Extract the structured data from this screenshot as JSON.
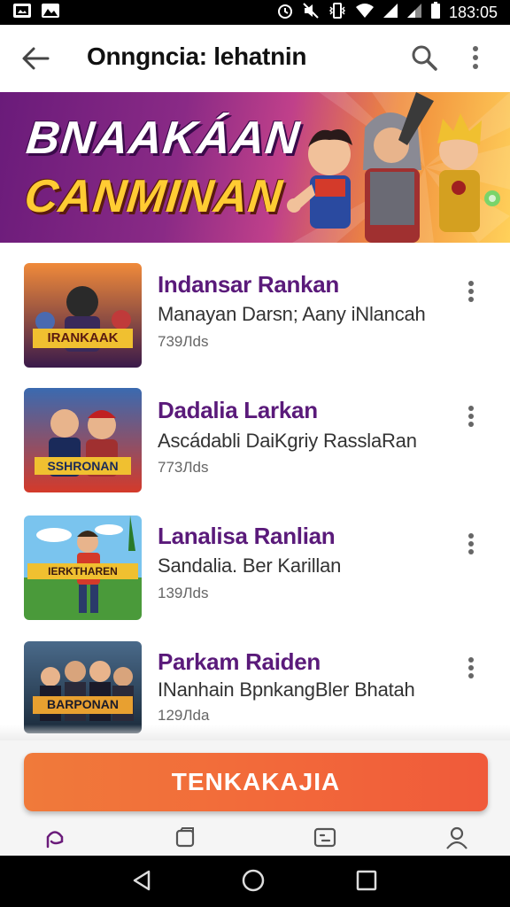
{
  "status_bar": {
    "time": "183:05",
    "icons": [
      "gallery-icon",
      "photo-icon",
      "alarm-icon",
      "mute-icon",
      "vibrate-icon",
      "wifi-icon",
      "signal-icon",
      "signal-icon",
      "battery-icon"
    ]
  },
  "app_bar": {
    "title": "Onngncia: lehatnin",
    "icons": [
      "back-arrow-icon",
      "search-icon",
      "more-vert-icon"
    ]
  },
  "banner": {
    "line1": "BNAAKÁAN",
    "line2": "CANMINAN"
  },
  "list": {
    "items": [
      {
        "title": "Indansar Rankan",
        "subtitle": "Manayan Darsn; Aany iNlancah",
        "meta": "739Лds",
        "thumb_text": "IRANKAAK",
        "colors": [
          "#e86a2a",
          "#2a2a6a"
        ]
      },
      {
        "title": "Dadalia Larkan",
        "subtitle": "Ascádabli DaiKgriy RasslaRan",
        "meta": "773Лds",
        "thumb_text": "SSHRONAN",
        "colors": [
          "#d43a2a",
          "#1a2a5a"
        ]
      },
      {
        "title": "Lanalisa Ranlian",
        "subtitle": "Sandalia. Ber Karillan",
        "meta": "139Лds",
        "thumb_text": "IERKTHAREN",
        "colors": [
          "#6ab8e8",
          "#4a8a3a"
        ]
      },
      {
        "title": "Parkam Raiden",
        "subtitle": "INanhain BpnkangBler Bhatah",
        "meta": "129Лda",
        "thumb_text": "BARPONAN",
        "colors": [
          "#2a4a6a",
          "#d89a3a"
        ]
      }
    ]
  },
  "cta": {
    "label": "TENKAKAJIA"
  },
  "bottom_nav": {
    "items": [
      "home-icon",
      "cards-icon",
      "messages-icon",
      "profile-icon"
    ],
    "active_color": "#6a1b7a"
  },
  "system_nav": {
    "items": [
      "back-triangle-icon",
      "home-circle-icon",
      "recents-square-icon"
    ]
  }
}
